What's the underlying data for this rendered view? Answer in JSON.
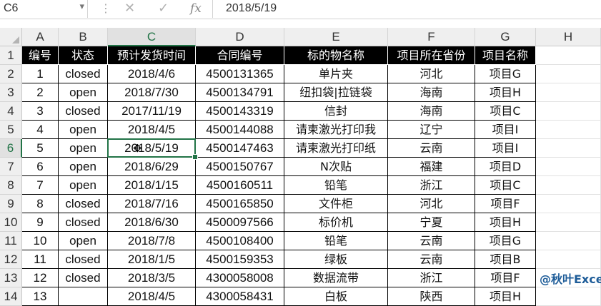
{
  "formula_bar": {
    "name_box": "C6",
    "name_box_arrow": "▾",
    "dots": "⋮",
    "cancel_icon": "✕",
    "enter_icon": "✓",
    "fx_label": "fx",
    "formula_value": "2018/5/19"
  },
  "columns": [
    "A",
    "B",
    "C",
    "D",
    "E",
    "F",
    "G",
    "H"
  ],
  "selected_column": "C",
  "row_numbers": [
    "1",
    "2",
    "3",
    "4",
    "5",
    "6",
    "7",
    "8",
    "9",
    "10",
    "11",
    "12",
    "13",
    "14"
  ],
  "selected_row": "6",
  "table": {
    "headers": [
      "编号",
      "状态",
      "预计发货时间",
      "合同编号",
      "标的物名称",
      "项目所在省份",
      "项目名称"
    ],
    "rows": [
      [
        "1",
        "closed",
        "2018/4/6",
        "4500131365",
        "单片夹",
        "河北",
        "项目G"
      ],
      [
        "2",
        "open",
        "2018/7/30",
        "4500134791",
        "纽扣袋|拉链袋",
        "海南",
        "项目H"
      ],
      [
        "3",
        "closed",
        "2017/11/19",
        "4500143319",
        "信封",
        "海南",
        "项目C"
      ],
      [
        "4",
        "open",
        "2018/4/5",
        "4500144088",
        "请柬激光打印我",
        "辽宁",
        "项目I"
      ],
      [
        "5",
        "open",
        "2018/5/19",
        "4500147463",
        "请柬激光打印纸",
        "云南",
        "项目I"
      ],
      [
        "6",
        "open",
        "2018/6/29",
        "4500150767",
        "N次贴",
        "福建",
        "项目D"
      ],
      [
        "7",
        "open",
        "2018/1/15",
        "4500160511",
        "铅笔",
        "浙江",
        "项目C"
      ],
      [
        "8",
        "closed",
        "2018/7/16",
        "4500165850",
        "文件柜",
        "河北",
        "项目F"
      ],
      [
        "9",
        "closed",
        "2018/6/30",
        "4500097566",
        "标价机",
        "宁夏",
        "项目H"
      ],
      [
        "10",
        "open",
        "2018/7/8",
        "4500108400",
        "铅笔",
        "云南",
        "项目G"
      ],
      [
        "11",
        "closed",
        "2018/1/5",
        "4500159353",
        "绿板",
        "云南",
        "项目B"
      ],
      [
        "12",
        "closed",
        "2018/3/5",
        "4300058008",
        "数据流带",
        "浙江",
        "项目F"
      ],
      [
        "13",
        "",
        "2018/4/5",
        "4300058431",
        "白板",
        "陕西",
        "项目H"
      ]
    ]
  },
  "cursor_icon": "✥",
  "watermark": "@秋叶Excel"
}
